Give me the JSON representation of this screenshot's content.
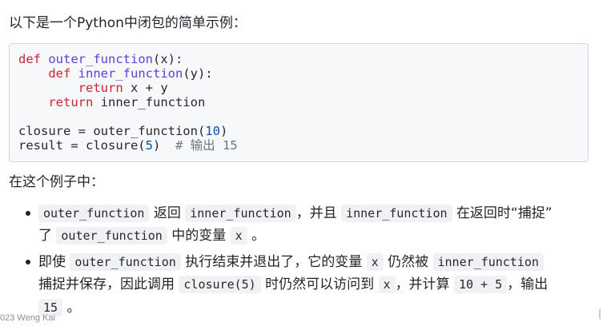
{
  "intro": "以下是一个Python中闭包的简单示例：",
  "code": {
    "l1": {
      "def": "def",
      "space": " ",
      "fn": "outer_function",
      "rest": "(x):"
    },
    "l2": {
      "indent": "    ",
      "def": "def",
      "space": " ",
      "fn": "inner_function",
      "rest": "(y):"
    },
    "l3": {
      "indent": "        ",
      "kw": "return",
      "rest": " x + y"
    },
    "l4": {
      "indent": "    ",
      "kw": "return",
      "rest": " inner_function"
    },
    "l6": {
      "pre": "closure = outer_function(",
      "num": "10",
      "post": ")"
    },
    "l7": {
      "pre": "result = closure(",
      "num": "5",
      "post": ")  ",
      "comment": "# 输出 15"
    }
  },
  "paragraph2": "在这个例子中：",
  "bullet1": {
    "line1": {
      "c1": "outer_function",
      "t1": " 返回 ",
      "c2": "inner_function",
      "t2": "，并且 ",
      "c3": "inner_function",
      "t3": " 在返回时“捕捉”"
    },
    "line2": {
      "t1": "了 ",
      "c1": "outer_function",
      "t2": " 中的变量 ",
      "c2": "x",
      "t3": " 。"
    }
  },
  "bullet2": {
    "line1": {
      "t0": "即使 ",
      "c1": "outer_function",
      "t1": " 执行结束并退出了，它的变量 ",
      "c2": "x",
      "t2": " 仍然被 ",
      "c3": "inner_function"
    },
    "line2": {
      "t1": "捕捉并保存，因此调用 ",
      "c1": "closure(5)",
      "t2": " 时仍然可以访问到 ",
      "c2": "x",
      "t3": "，并计算 ",
      "c3": "10 + 5",
      "t4": "，输出"
    },
    "line3": {
      "c1": "15",
      "t1": " 。"
    }
  },
  "footer": "023 Weng Kai"
}
